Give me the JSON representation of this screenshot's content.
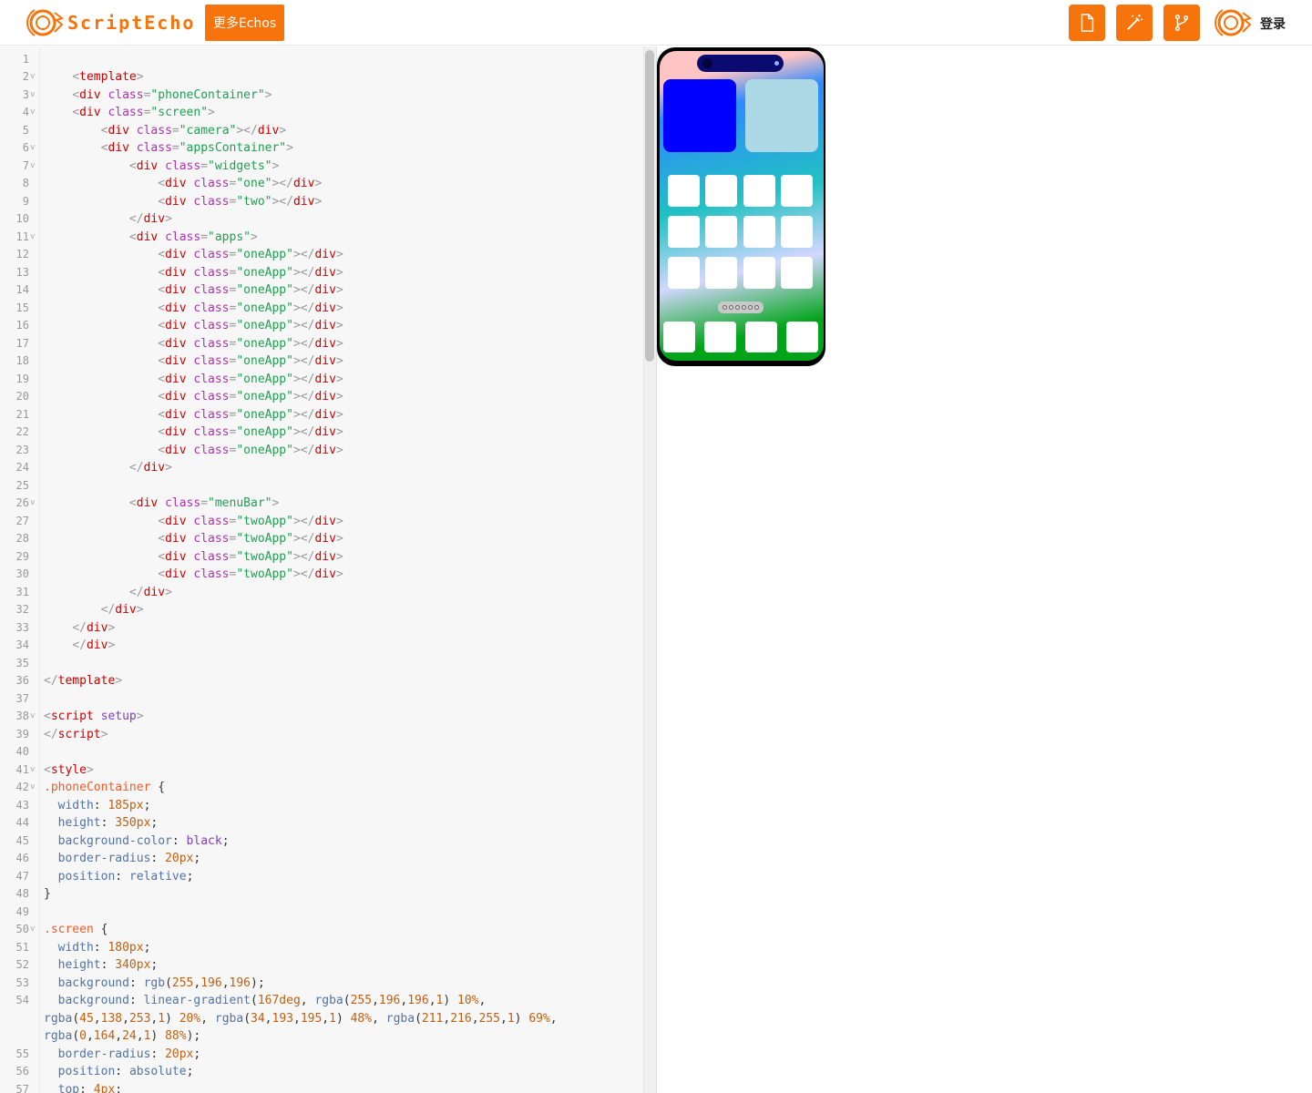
{
  "header": {
    "logo_text": "ScriptEcho",
    "more_button": "更多Echos",
    "login": "登录"
  },
  "colors": {
    "accent": "#f7740c"
  },
  "icons": {
    "new_file": "file-icon",
    "magic": "magic-wand-icon",
    "branch": "git-branch-icon"
  },
  "editor": {
    "lines": [
      {
        "n": "1",
        "f": "",
        "h": ""
      },
      {
        "n": "2",
        "f": "v",
        "h": "    <b><</b><t>template</t><b>></b>"
      },
      {
        "n": "3",
        "f": "v",
        "h": "    <b><</b><t>div</t> <a>class</a><b>=</b><s>\"phoneContainer\"</s><b>></b>"
      },
      {
        "n": "4",
        "f": "v",
        "h": "    <b><</b><t>div</t> <a>class</a><b>=</b><s>\"screen\"</s><b>></b>"
      },
      {
        "n": "5",
        "f": "",
        "h": "        <b><</b><t>div</t> <a>class</a><b>=</b><s>\"camera\"</s><b>></</b><t>div</t><b>></b>"
      },
      {
        "n": "6",
        "f": "v",
        "h": "        <b><</b><t>div</t> <a>class</a><b>=</b><s>\"appsContainer\"</s><b>></b>"
      },
      {
        "n": "7",
        "f": "v",
        "h": "            <b><</b><t>div</t> <a>class</a><b>=</b><s>\"widgets\"</s><b>></b>"
      },
      {
        "n": "8",
        "f": "",
        "h": "                <b><</b><t>div</t> <a>class</a><b>=</b><s>\"one\"</s><b>></</b><t>div</t><b>></b>"
      },
      {
        "n": "9",
        "f": "",
        "h": "                <b><</b><t>div</t> <a>class</a><b>=</b><s>\"two\"</s><b>></</b><t>div</t><b>></b>"
      },
      {
        "n": "10",
        "f": "",
        "h": "            <b></</b><t>div</t><b>></b>"
      },
      {
        "n": "11",
        "f": "v",
        "h": "            <b><</b><t>div</t> <a>class</a><b>=</b><s>\"apps\"</s><b>></b>"
      },
      {
        "n": "12",
        "f": "",
        "h": "                <b><</b><t>div</t> <a>class</a><b>=</b><s>\"oneApp\"</s><b>></</b><t>div</t><b>></b>"
      },
      {
        "n": "13",
        "f": "",
        "h": "                <b><</b><t>div</t> <a>class</a><b>=</b><s>\"oneApp\"</s><b>></</b><t>div</t><b>></b>"
      },
      {
        "n": "14",
        "f": "",
        "h": "                <b><</b><t>div</t> <a>class</a><b>=</b><s>\"oneApp\"</s><b>></</b><t>div</t><b>></b>"
      },
      {
        "n": "15",
        "f": "",
        "h": "                <b><</b><t>div</t> <a>class</a><b>=</b><s>\"oneApp\"</s><b>></</b><t>div</t><b>></b>"
      },
      {
        "n": "16",
        "f": "",
        "h": "                <b><</b><t>div</t> <a>class</a><b>=</b><s>\"oneApp\"</s><b>></</b><t>div</t><b>></b>"
      },
      {
        "n": "17",
        "f": "",
        "h": "                <b><</b><t>div</t> <a>class</a><b>=</b><s>\"oneApp\"</s><b>></</b><t>div</t><b>></b>"
      },
      {
        "n": "18",
        "f": "",
        "h": "                <b><</b><t>div</t> <a>class</a><b>=</b><s>\"oneApp\"</s><b>></</b><t>div</t><b>></b>"
      },
      {
        "n": "19",
        "f": "",
        "h": "                <b><</b><t>div</t> <a>class</a><b>=</b><s>\"oneApp\"</s><b>></</b><t>div</t><b>></b>"
      },
      {
        "n": "20",
        "f": "",
        "h": "                <b><</b><t>div</t> <a>class</a><b>=</b><s>\"oneApp\"</s><b>></</b><t>div</t><b>></b>"
      },
      {
        "n": "21",
        "f": "",
        "h": "                <b><</b><t>div</t> <a>class</a><b>=</b><s>\"oneApp\"</s><b>></</b><t>div</t><b>></b>"
      },
      {
        "n": "22",
        "f": "",
        "h": "                <b><</b><t>div</t> <a>class</a><b>=</b><s>\"oneApp\"</s><b>></</b><t>div</t><b>></b>"
      },
      {
        "n": "23",
        "f": "",
        "h": "                <b><</b><t>div</t> <a>class</a><b>=</b><s>\"oneApp\"</s><b>></</b><t>div</t><b>></b>"
      },
      {
        "n": "24",
        "f": "",
        "h": "            <b></</b><t>div</t><b>></b>"
      },
      {
        "n": "25",
        "f": "",
        "h": ""
      },
      {
        "n": "26",
        "f": "v",
        "h": "            <b><</b><t>div</t> <a>class</a><b>=</b><s>\"menuBar\"</s><b>></b>"
      },
      {
        "n": "27",
        "f": "",
        "h": "                <b><</b><t>div</t> <a>class</a><b>=</b><s>\"twoApp\"</s><b>></</b><t>div</t><b>></b>"
      },
      {
        "n": "28",
        "f": "",
        "h": "                <b><</b><t>div</t> <a>class</a><b>=</b><s>\"twoApp\"</s><b>></</b><t>div</t><b>></b>"
      },
      {
        "n": "29",
        "f": "",
        "h": "                <b><</b><t>div</t> <a>class</a><b>=</b><s>\"twoApp\"</s><b>></</b><t>div</t><b>></b>"
      },
      {
        "n": "30",
        "f": "",
        "h": "                <b><</b><t>div</t> <a>class</a><b>=</b><s>\"twoApp\"</s><b>></</b><t>div</t><b>></b>"
      },
      {
        "n": "31",
        "f": "",
        "h": "            <b></</b><t>div</t><b>></b>"
      },
      {
        "n": "32",
        "f": "",
        "h": "        <b></</b><t>div</t><b>></b>"
      },
      {
        "n": "33",
        "f": "",
        "h": "    <b></</b><t>div</t><b>></b>"
      },
      {
        "n": "34",
        "f": "",
        "h": "    <b></</b><t>div</t><b>></b>"
      },
      {
        "n": "35",
        "f": "",
        "h": ""
      },
      {
        "n": "36",
        "f": "",
        "h": "<b></</b><t>template</t><b>></b>"
      },
      {
        "n": "37",
        "f": "",
        "h": ""
      },
      {
        "n": "38",
        "f": "v",
        "h": "<b><</b><t>script</t> <k>setup</k><b>></b>"
      },
      {
        "n": "39",
        "f": "",
        "h": "<b></</b><t>script</t><b>></b>"
      },
      {
        "n": "40",
        "f": "",
        "h": ""
      },
      {
        "n": "41",
        "f": "v",
        "h": "<b><</b><t>style</t><b>></b>"
      },
      {
        "n": "42",
        "f": "v",
        "h": "<e>.phoneContainer</e> {"
      },
      {
        "n": "43",
        "f": "",
        "h": "  <p>width</p>: <u>185px</u>;"
      },
      {
        "n": "44",
        "f": "",
        "h": "  <p>height</p>: <u>350px</u>;"
      },
      {
        "n": "45",
        "f": "",
        "h": "  <p>background-color</p>: <k>black</k>;"
      },
      {
        "n": "46",
        "f": "",
        "h": "  <p>border-radius</p>: <u>20px</u>;"
      },
      {
        "n": "47",
        "f": "",
        "h": "  <p>position</p>: <p>relative</p>;"
      },
      {
        "n": "48",
        "f": "",
        "h": "}"
      },
      {
        "n": "49",
        "f": "",
        "h": ""
      },
      {
        "n": "50",
        "f": "v",
        "h": "<e>.screen</e> {"
      },
      {
        "n": "51",
        "f": "",
        "h": "  <p>width</p>: <u>180px</u>;"
      },
      {
        "n": "52",
        "f": "",
        "h": "  <p>height</p>: <u>340px</u>;"
      },
      {
        "n": "53",
        "f": "",
        "h": "  <p>background</p>: <p>rgb</p>(<u>255</u>,<u>196</u>,<u>196</u>);"
      },
      {
        "n": "54",
        "f": "",
        "h": "  <p>background</p>: <p>linear-gradient</p>(<u>167deg</u>, <p>rgba</p>(<u>255</u>,<u>196</u>,<u>196</u>,<u>1</u>) <u>10%</u>,"
      },
      {
        "n": "",
        "f": "",
        "h": "<p>rgba</p>(<u>45</u>,<u>138</u>,<u>253</u>,<u>1</u>) <u>20%</u>, <p>rgba</p>(<u>34</u>,<u>193</u>,<u>195</u>,<u>1</u>) <u>48%</u>, <p>rgba</p>(<u>211</u>,<u>216</u>,<u>255</u>,<u>1</u>) <u>69%</u>,"
      },
      {
        "n": "",
        "f": "",
        "h": "<p>rgba</p>(<u>0</u>,<u>164</u>,<u>24</u>,<u>1</u>) <u>88%</u>);"
      },
      {
        "n": "55",
        "f": "",
        "h": "  <p>border-radius</p>: <u>20px</u>;"
      },
      {
        "n": "56",
        "f": "",
        "h": "  <p>position</p>: <p>absolute</p>;"
      },
      {
        "n": "57",
        "f": "",
        "h": "  <p>top</p>: <u>4px</u>;"
      }
    ]
  }
}
